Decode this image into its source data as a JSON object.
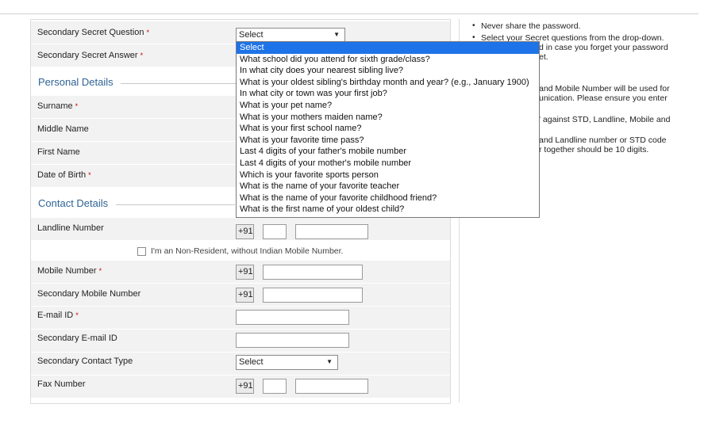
{
  "form": {
    "secondary_secret_question": {
      "label": "Secondary Secret Question",
      "value": "Select"
    },
    "secondary_secret_answer": {
      "label": "Secondary Secret Answer"
    },
    "personal_details_heading": "Personal Details",
    "surname": {
      "label": "Surname"
    },
    "middle_name": {
      "label": "Middle Name"
    },
    "first_name": {
      "label": "First Name"
    },
    "date_of_birth": {
      "label": "Date of Birth"
    },
    "contact_details_heading": "Contact Details",
    "landline": {
      "label": "Landline Number",
      "code": "+91"
    },
    "non_resident": {
      "label": "I'm an Non-Resident, without Indian Mobile Number."
    },
    "mobile": {
      "label": "Mobile Number",
      "code": "+91"
    },
    "secondary_mobile": {
      "label": "Secondary Mobile Number",
      "code": "+91"
    },
    "email": {
      "label": "E-mail ID"
    },
    "secondary_email": {
      "label": "Secondary E-mail ID"
    },
    "secondary_contact_type": {
      "label": "Secondary Contact Type",
      "value": "Select"
    },
    "fax": {
      "label": "Fax Number",
      "code": "+91"
    },
    "required_mark": "*"
  },
  "dropdown": {
    "options": [
      "Select",
      "What school did you attend for sixth grade/class?",
      "In what city does your nearest sibling live?",
      "What is your oldest sibling's birthday month and year? (e.g., January 1900)",
      "In what city or town was your first job?",
      "What is your pet name?",
      "What is your mothers maiden name?",
      "What is your first school name?",
      "What is your favorite time pass?",
      "Last 4 digits of your father's mobile number",
      "Last 4 digits of your mother's mobile number",
      "Which is your favorite sports person",
      "What is the name of your favorite teacher",
      "What is the name of your favorite childhood friend?",
      "What is the first name of your oldest child?"
    ]
  },
  "notes": {
    "bullet": "•",
    "n1": "Never share the password.",
    "n2": "Select your Secret questions from the drop-down.",
    "n3": "d in case you forget your password",
    "n4": "et.",
    "n5": "and Mobile Number will be used for",
    "n6": "unication. Please ensure you enter",
    "n7": "' against STD, Landline, Mobile and",
    "n8": "and Landline number or STD code",
    "n9": "r together should be 10 digits."
  },
  "colors": {
    "accent": "#2f6496",
    "highlight": "#1e73e8",
    "required": "#cc0000"
  },
  "icons": {
    "dropdown_arrow": "▼"
  }
}
